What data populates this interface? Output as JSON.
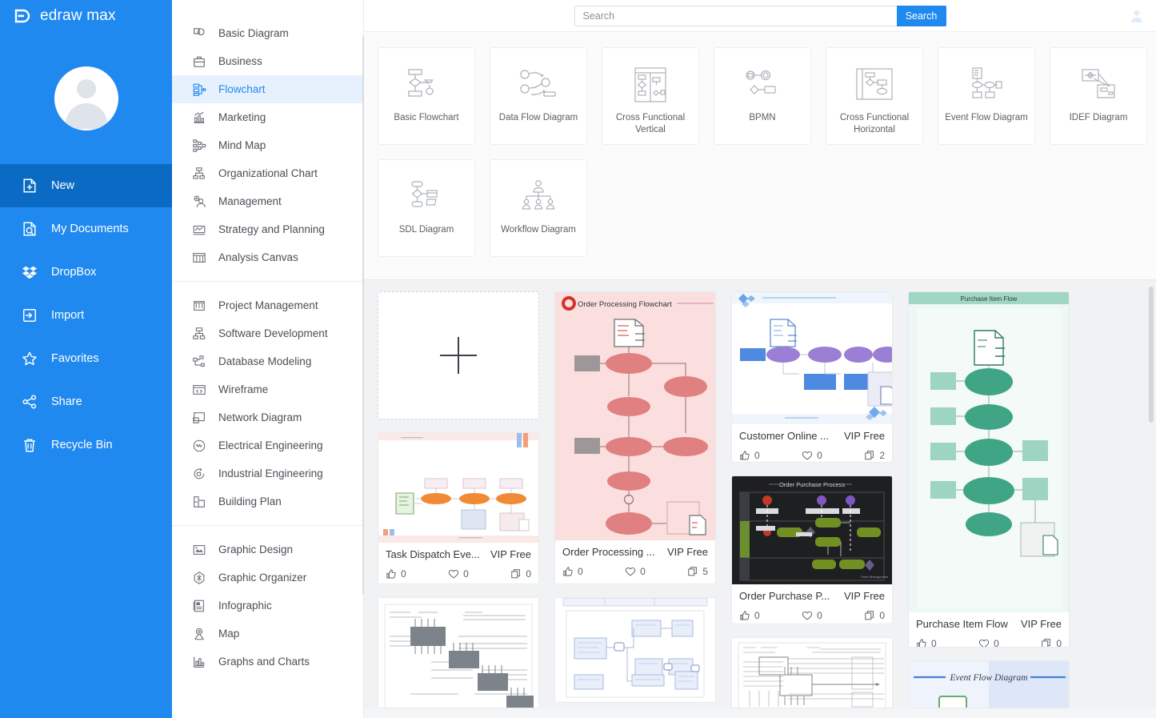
{
  "brand": {
    "name": "edraw max",
    "logo_icon": "edraw-logo-icon"
  },
  "colors": {
    "accent": "#2089f0",
    "sidebar_bg": "#2089f0",
    "sidebar_active": "#0b6bc4",
    "gallery_bg": "#f1f2f3"
  },
  "sidebar": {
    "avatar_icon": "user-avatar-icon",
    "items": [
      {
        "label": "New",
        "icon": "new-document-icon",
        "active": true
      },
      {
        "label": "My Documents",
        "icon": "my-documents-icon",
        "active": false
      },
      {
        "label": "DropBox",
        "icon": "dropbox-icon",
        "active": false
      },
      {
        "label": "Import",
        "icon": "import-icon",
        "active": false
      },
      {
        "label": "Favorites",
        "icon": "star-icon",
        "active": false
      },
      {
        "label": "Share",
        "icon": "share-icon",
        "active": false
      },
      {
        "label": "Recycle Bin",
        "icon": "trash-icon",
        "active": false
      }
    ]
  },
  "categories": {
    "groups": [
      {
        "items": [
          {
            "label": "Basic Diagram",
            "icon": "basic-diagram-icon",
            "active": false
          },
          {
            "label": "Business",
            "icon": "briefcase-icon",
            "active": false
          },
          {
            "label": "Flowchart",
            "icon": "flowchart-icon",
            "active": true
          },
          {
            "label": "Marketing",
            "icon": "marketing-chart-icon",
            "active": false
          },
          {
            "label": "Mind Map",
            "icon": "mind-map-icon",
            "active": false
          },
          {
            "label": "Organizational Chart",
            "icon": "org-chart-icon",
            "active": false
          },
          {
            "label": "Management",
            "icon": "management-icon",
            "active": false
          },
          {
            "label": "Strategy and Planning",
            "icon": "strategy-icon",
            "active": false
          },
          {
            "label": "Analysis Canvas",
            "icon": "analysis-canvas-icon",
            "active": false
          }
        ]
      },
      {
        "items": [
          {
            "label": "Project Management",
            "icon": "project-management-icon",
            "active": false
          },
          {
            "label": "Software Development",
            "icon": "software-development-icon",
            "active": false
          },
          {
            "label": "Database Modeling",
            "icon": "database-modeling-icon",
            "active": false
          },
          {
            "label": "Wireframe",
            "icon": "wireframe-icon",
            "active": false
          },
          {
            "label": "Network Diagram",
            "icon": "network-diagram-icon",
            "active": false
          },
          {
            "label": "Electrical Engineering",
            "icon": "electrical-engineering-icon",
            "active": false
          },
          {
            "label": "Industrial Engineering",
            "icon": "industrial-engineering-icon",
            "active": false
          },
          {
            "label": "Building Plan",
            "icon": "building-plan-icon",
            "active": false
          }
        ]
      },
      {
        "items": [
          {
            "label": "Graphic Design",
            "icon": "graphic-design-icon",
            "active": false
          },
          {
            "label": "Graphic Organizer",
            "icon": "graphic-organizer-icon",
            "active": false
          },
          {
            "label": "Infographic",
            "icon": "infographic-icon",
            "active": false
          },
          {
            "label": "Map",
            "icon": "map-pin-icon",
            "active": false
          },
          {
            "label": "Graphs and Charts",
            "icon": "graphs-charts-icon",
            "active": false
          }
        ]
      }
    ]
  },
  "search": {
    "placeholder": "Search",
    "value": "",
    "button_label": "Search",
    "user_icon": "account-icon"
  },
  "template_types": {
    "row1": [
      {
        "label": "Basic Flowchart",
        "icon": "basic-flowchart-thumb"
      },
      {
        "label": "Data Flow Diagram",
        "icon": "data-flow-diagram-thumb"
      },
      {
        "label": "Cross Functional Vertical",
        "icon": "cross-functional-vertical-thumb"
      },
      {
        "label": "BPMN",
        "icon": "bpmn-thumb"
      },
      {
        "label": "Cross Functional Horizontal",
        "icon": "cross-functional-horizontal-thumb"
      },
      {
        "label": "Event Flow Diagram",
        "icon": "event-flow-diagram-thumb"
      },
      {
        "label": "IDEF Diagram",
        "icon": "idef-diagram-thumb"
      }
    ],
    "row2": [
      {
        "label": "SDL Diagram",
        "icon": "sdl-diagram-thumb"
      },
      {
        "label": "Workflow Diagram",
        "icon": "workflow-diagram-thumb"
      }
    ]
  },
  "gallery": {
    "new_card": {
      "icon": "plus-icon",
      "label": ""
    },
    "items": [
      {
        "title": "Task Dispatch Eve...",
        "vip": "VIP Free",
        "likes": "0",
        "favorites": "0",
        "copies": "0",
        "thumb_title": "",
        "thumb_style": "task-dispatch"
      },
      {
        "title": "Order Processing ...",
        "vip": "VIP Free",
        "likes": "0",
        "favorites": "0",
        "copies": "5",
        "thumb_title": "Order Processing Flowchart",
        "thumb_style": "order-processing"
      },
      {
        "title": "Customer Online ...",
        "vip": "VIP Free",
        "likes": "0",
        "favorites": "0",
        "copies": "2",
        "thumb_title": "",
        "thumb_style": "customer-online"
      },
      {
        "title": "Order Purchase P...",
        "vip": "VIP Free",
        "likes": "0",
        "favorites": "0",
        "copies": "0",
        "thumb_title": "Order Purchase Process",
        "thumb_style": "order-purchase"
      },
      {
        "title": "Purchase Item Flow",
        "vip": "VIP Free",
        "likes": "0",
        "favorites": "0",
        "copies": "0",
        "thumb_title": "Purchase Item Flow",
        "thumb_style": "purchase-item"
      }
    ],
    "partial_items": [
      {
        "thumb_style": "electrical-schematic",
        "thumb_title": ""
      },
      {
        "thumb_style": "blue-blocks",
        "thumb_title": ""
      },
      {
        "thumb_style": "wide-schematic",
        "thumb_title": ""
      },
      {
        "thumb_style": "event-flow",
        "thumb_title": "Event Flow Diagram"
      }
    ]
  }
}
